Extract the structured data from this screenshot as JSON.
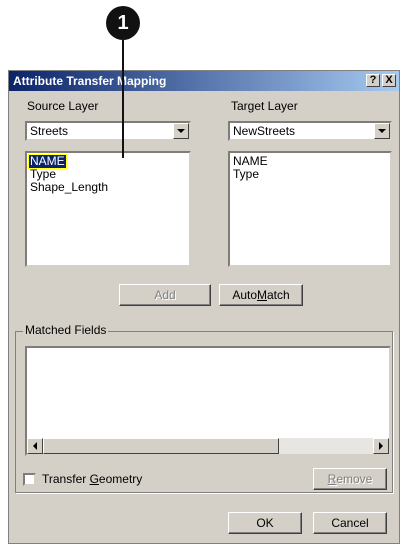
{
  "callout": {
    "number": "1"
  },
  "window": {
    "title": "Attribute Transfer Mapping",
    "help_button": "?",
    "close_button": "X"
  },
  "source": {
    "label": "Source Layer",
    "selected": "Streets",
    "fields": [
      "NAME",
      "Type",
      "Shape_Length"
    ],
    "selected_field": "NAME"
  },
  "target": {
    "label": "Target Layer",
    "selected": "NewStreets",
    "fields": [
      "NAME",
      "Type"
    ]
  },
  "buttons": {
    "add": "Add",
    "auto_match_pre": "Auto ",
    "auto_match_acc": "M",
    "auto_match_post": "atch",
    "remove_acc": "R",
    "remove_post": "emove",
    "ok": "OK",
    "cancel": "Cancel"
  },
  "matched": {
    "legend": "Matched Fields"
  },
  "transfer_geometry": {
    "label_pre": "Transfer ",
    "label_acc": "G",
    "label_post": "eometry",
    "checked": false
  }
}
